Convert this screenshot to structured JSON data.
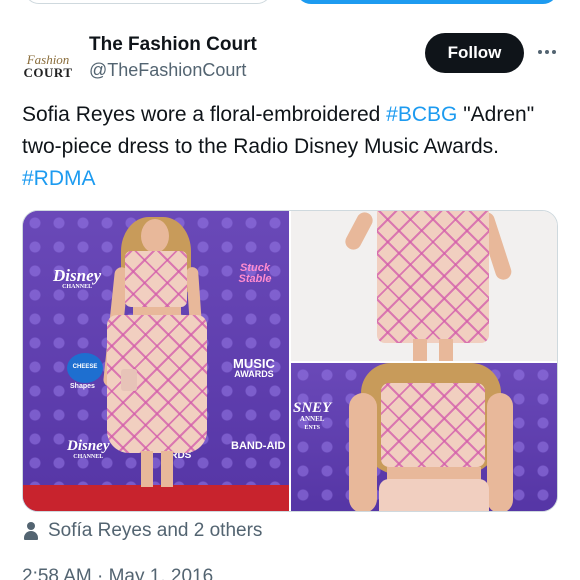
{
  "account": {
    "avatar_line1": "Fashion",
    "avatar_line2": "COURT",
    "display_name": "The Fashion Court",
    "handle": "@TheFashionCourt"
  },
  "actions": {
    "follow_label": "Follow",
    "more_icon": "more-horizontal-icon"
  },
  "tweet": {
    "text_1": "Sofia Reyes wore a floral-embroidered ",
    "hashtag_1": "#BCBG",
    "text_2": " \"Adren\" two-piece dress to the Radio Disney Music Awards. ",
    "hashtag_2": "#RDMA"
  },
  "media": {
    "backdrop_logos": {
      "disney_1": "Disney",
      "disney_1_sub": "CHANNEL",
      "stuck": "Stuck Stable",
      "music": "MUSIC",
      "awards": "AWARDS",
      "kraft": "CHEESE",
      "shapes": "Shapes",
      "disney_2": "Disney",
      "disney_2_sub": "CHANNEL",
      "ards": "ARDS",
      "band_aid": "BAND-AID",
      "sney": "SNEY",
      "annel": "ANNEL",
      "ents": "ENTS"
    },
    "colors": {
      "backdrop": "#5a3aa8",
      "carpet": "#c8232d",
      "dress": "#f1cfc0",
      "embroidery": "#d25aaa"
    }
  },
  "social_context": {
    "icon": "person-icon",
    "text": "Sofía Reyes and 2 others"
  },
  "meta": {
    "timestamp": "2:58 AM · May 1, 2016"
  },
  "colors": {
    "link": "#1d9bf0",
    "secondary_text": "#536471",
    "follow_bg": "#0f1419"
  }
}
